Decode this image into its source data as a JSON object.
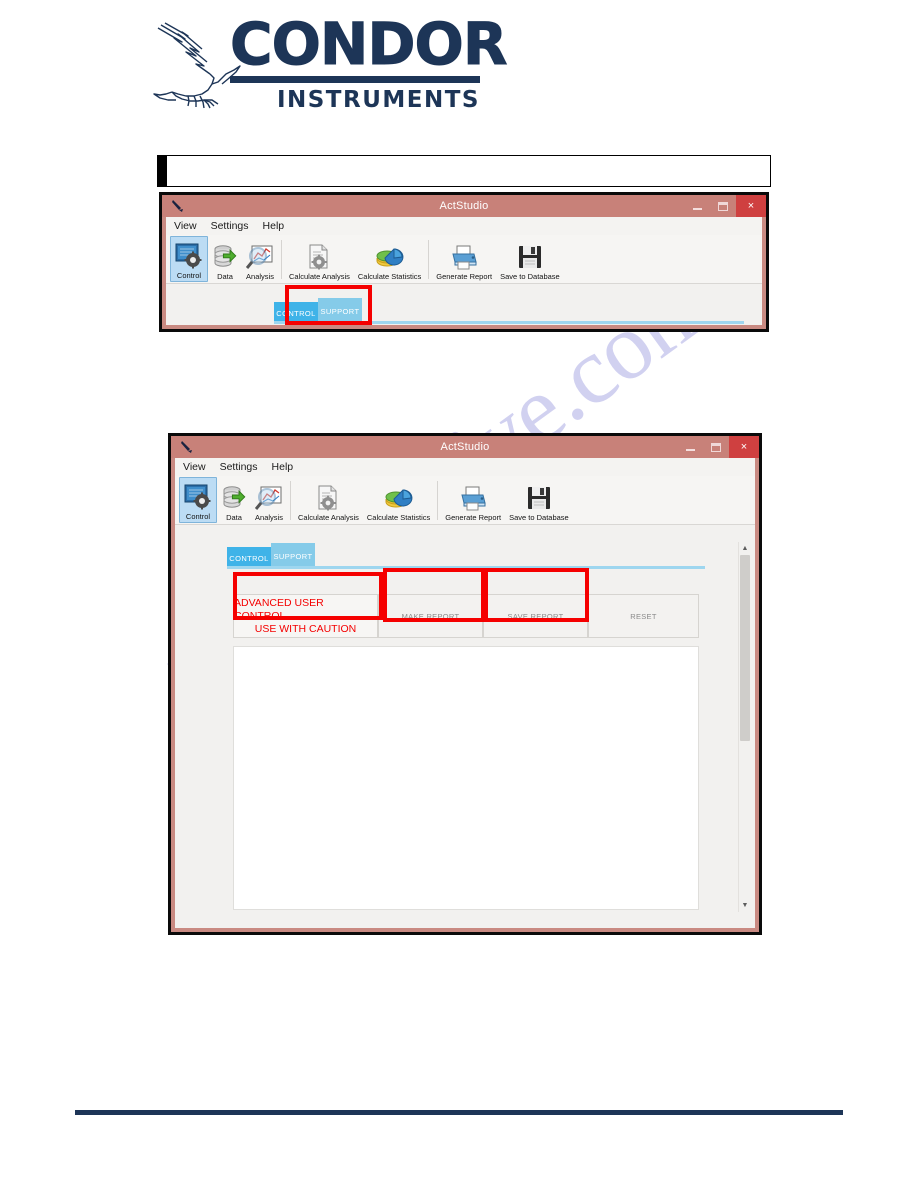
{
  "page": {
    "watermark": "manualshive.com",
    "logo": {
      "word": "CONDOR",
      "subtitle": "INSTRUMENTS",
      "bird_icon": "condor-bird-icon",
      "color": "#1d3557"
    },
    "title_box": {
      "text": ""
    },
    "footer_rule_color": "#1d3557"
  },
  "window1": {
    "titlebar": {
      "title": "ActStudio",
      "app_icon": "actstudio-app-icon",
      "minimize": "–",
      "maximize": "□",
      "close": "×"
    },
    "menu": [
      "View",
      "Settings",
      "Help"
    ],
    "toolbar": [
      {
        "label": "Control",
        "icon": "control-panel-icon",
        "selected": true
      },
      {
        "label": "Data",
        "icon": "database-icon",
        "selected": false
      },
      {
        "label": "Analysis",
        "icon": "magnifier-chart-icon",
        "selected": false
      },
      {
        "label": "Calculate Analysis",
        "icon": "document-gear-icon",
        "selected": false
      },
      {
        "label": "Calculate Statistics",
        "icon": "pie-chart-icon",
        "selected": false
      },
      {
        "label": "Generate Report",
        "icon": "printer-icon",
        "selected": false
      },
      {
        "label": "Save to Database",
        "icon": "floppy-disk-icon",
        "selected": false
      }
    ],
    "tabs": [
      {
        "label": "CONTROL",
        "color": "#3fb3e8"
      },
      {
        "label": "SUPPORT",
        "color": "#85cbe9"
      }
    ],
    "highlight": {
      "target": "SUPPORT",
      "color": "#f50000"
    }
  },
  "window2": {
    "titlebar": {
      "title": "ActStudio",
      "app_icon": "actstudio-app-icon",
      "minimize": "–",
      "maximize": "□",
      "close": "×"
    },
    "menu": [
      "View",
      "Settings",
      "Help"
    ],
    "toolbar": [
      {
        "label": "Control",
        "icon": "control-panel-icon",
        "selected": true
      },
      {
        "label": "Data",
        "icon": "database-icon",
        "selected": false
      },
      {
        "label": "Analysis",
        "icon": "magnifier-chart-icon",
        "selected": false
      },
      {
        "label": "Calculate Analysis",
        "icon": "document-gear-icon",
        "selected": false
      },
      {
        "label": "Calculate Statistics",
        "icon": "pie-chart-icon",
        "selected": false
      },
      {
        "label": "Generate Report",
        "icon": "printer-icon",
        "selected": false
      },
      {
        "label": "Save to Database",
        "icon": "floppy-disk-icon",
        "selected": false
      }
    ],
    "tabs": [
      {
        "label": "CONTROL",
        "color": "#3fb3e8"
      },
      {
        "label": "SUPPORT",
        "color": "#85cbe9"
      }
    ],
    "warning": {
      "line1": "ADVANCED USER CONTROL",
      "line2": "USE WITH CAUTION",
      "color": "#f40000"
    },
    "buttons": [
      {
        "label": "MAKE REPORT",
        "highlighted": true
      },
      {
        "label": "SAVE REPORT",
        "highlighted": true
      },
      {
        "label": "RESET",
        "highlighted": false
      }
    ],
    "scrollbar": {
      "up_arrow": "▲",
      "down_arrow": "▼"
    }
  }
}
